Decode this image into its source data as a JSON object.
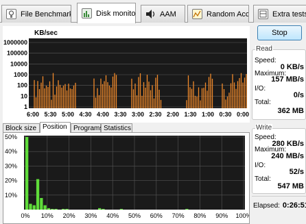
{
  "tabs": [
    {
      "label": "File Benchmark",
      "icon": "benchmark-icon",
      "active": false
    },
    {
      "label": "Disk monitor",
      "icon": "chart-icon",
      "active": true
    },
    {
      "label": "AAM",
      "icon": "speaker-icon",
      "active": false
    },
    {
      "label": "Random Access",
      "icon": "random-access-icon",
      "active": false
    },
    {
      "label": "Extra tests",
      "icon": "extra-tests-icon",
      "active": false
    }
  ],
  "graph": {
    "unit": "KB/sec",
    "y_ticks": [
      "1000000",
      "100000",
      "10000",
      "1000",
      "100",
      "10",
      "1"
    ],
    "x_ticks": [
      "6:00",
      "5:30",
      "5:00",
      "4:30",
      "4:00",
      "3:30",
      "3:00",
      "2:30",
      "2:00",
      "1:30",
      "1:00",
      "0:30",
      "0:00"
    ],
    "bar_color": "#f08a2a",
    "background": "#1a1a1a",
    "grid_color": "#5a5a5a"
  },
  "chart_data": {
    "type": "bar",
    "title": "",
    "xlabel": "",
    "ylabel": "KB/sec",
    "ylim": [
      1,
      1000000
    ],
    "log_scale": true
  },
  "subtabs": [
    {
      "label": "Block size",
      "active": false
    },
    {
      "label": "Position",
      "active": true
    },
    {
      "label": "Programs",
      "active": false
    },
    {
      "label": "Statistics",
      "active": false
    }
  ],
  "histogram": {
    "y_ticks": [
      "50%",
      "40%",
      "30%",
      "20%",
      "10%"
    ],
    "x_ticks": [
      "0%",
      "10%",
      "20%",
      "30%",
      "40%",
      "50%",
      "60%",
      "70%",
      "80%",
      "90%",
      "100%"
    ],
    "bar_color": "#5fdc3a",
    "background": "#1a1a1a",
    "values_percent": [
      50,
      4,
      3,
      21,
      8,
      3,
      1,
      0.5,
      0.5,
      0,
      0.5,
      0.5,
      0,
      0,
      0,
      0,
      0,
      0,
      0,
      0,
      1,
      0.5,
      0,
      0,
      0,
      0,
      0.5,
      0,
      0,
      0,
      0,
      0,
      0,
      0,
      0,
      0,
      0,
      0,
      0,
      0,
      0,
      0,
      0,
      0,
      0.5,
      0,
      0,
      0,
      0,
      0,
      0,
      0,
      0,
      0,
      0,
      0,
      0,
      0,
      0,
      0
    ]
  },
  "controls": {
    "stop_label": "Stop"
  },
  "read": {
    "title": "Read",
    "speed_label": "Speed:",
    "speed": "0 KB/s",
    "max_label": "Maximum:",
    "max": "157 MB/s",
    "io_label": "I/O:",
    "io": "0/s",
    "total_label": "Total:",
    "total": "362 MB"
  },
  "write": {
    "title": "Write",
    "speed_label": "Speed:",
    "speed": "280 KB/s",
    "max_label": "Maximum:",
    "max": "240 MB/s",
    "io_label": "I/O:",
    "io": "52/s",
    "total_label": "Total:",
    "total": "547 MB"
  },
  "elapsed": {
    "label": "Elapsed:",
    "value": "0:26:51"
  }
}
